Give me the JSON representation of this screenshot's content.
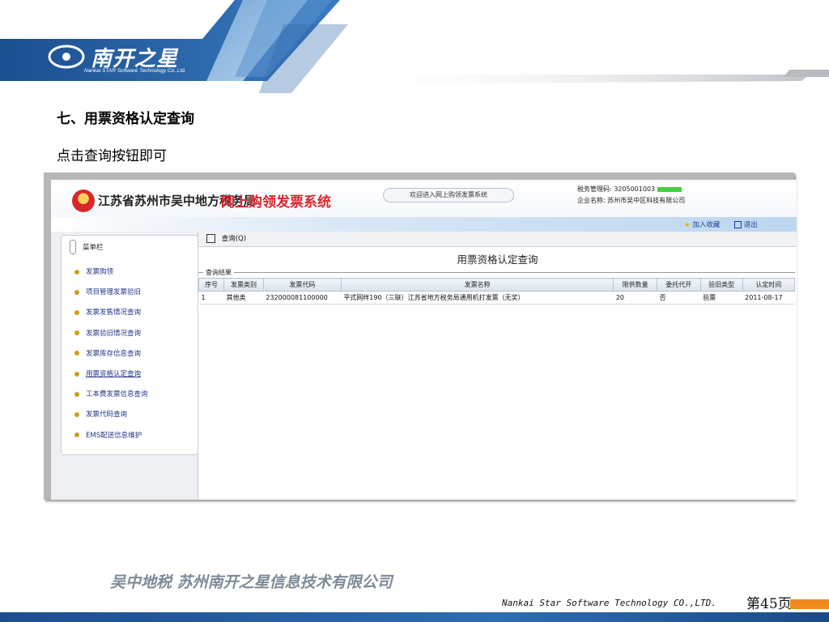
{
  "slide": {
    "logo_text": "南开之星",
    "logo_subtitle": "Nankai STAR Software Technology Co.,Ltd.",
    "heading": "七、用票资格认定查询",
    "instruction": "点击查询按钮即可",
    "footer_left": "吴中地税    苏州南开之星信息技术有限公司",
    "footer_en": "Nankai Star Software Technology CO.,LTD.",
    "page_number": "第45页",
    "colors": {
      "brand_blue": "#1d4d8e",
      "accent_orange": "#f08a1c"
    }
  },
  "app": {
    "title_part1": "江苏省苏州市吴中地方税务局",
    "title_part2": "网上购领发票系统",
    "welcome": "欢迎进入网上购领发票系统",
    "tax_code_label": "税务管理码: 3205001003",
    "company_label": "企业名称:  苏州市吴中区科技有限公司",
    "links": {
      "favorite": "加入收藏",
      "logout": "退出"
    },
    "sidebar": {
      "title": "菜单栏",
      "items": [
        {
          "label": "发票购领"
        },
        {
          "label": "项目管理发票验旧"
        },
        {
          "label": "发票发售情况查询"
        },
        {
          "label": "发票验旧情况查询"
        },
        {
          "label": "发票库存信息查询"
        },
        {
          "label": "用票资格认定查询"
        },
        {
          "label": "工本费发票信息查询"
        },
        {
          "label": "发票代码查询"
        },
        {
          "label": "EMS配送信息维护"
        }
      ],
      "active_index": 5
    },
    "main": {
      "query_button": "查询(Q)",
      "page_title": "用票资格认定查询",
      "group_label": "查询结果",
      "table": {
        "headers": [
          "序号",
          "发票类别",
          "发票代码",
          "发票名称",
          "限供数量",
          "委托代开",
          "验旧类型",
          "认定时间"
        ],
        "rows": [
          [
            "1",
            "其他类",
            "232000081100000",
            "平式网样190（三联）江苏省地方税务局通用机打发票（无奖）",
            "20",
            "否",
            "验票",
            "2011-08-17"
          ]
        ]
      }
    }
  }
}
